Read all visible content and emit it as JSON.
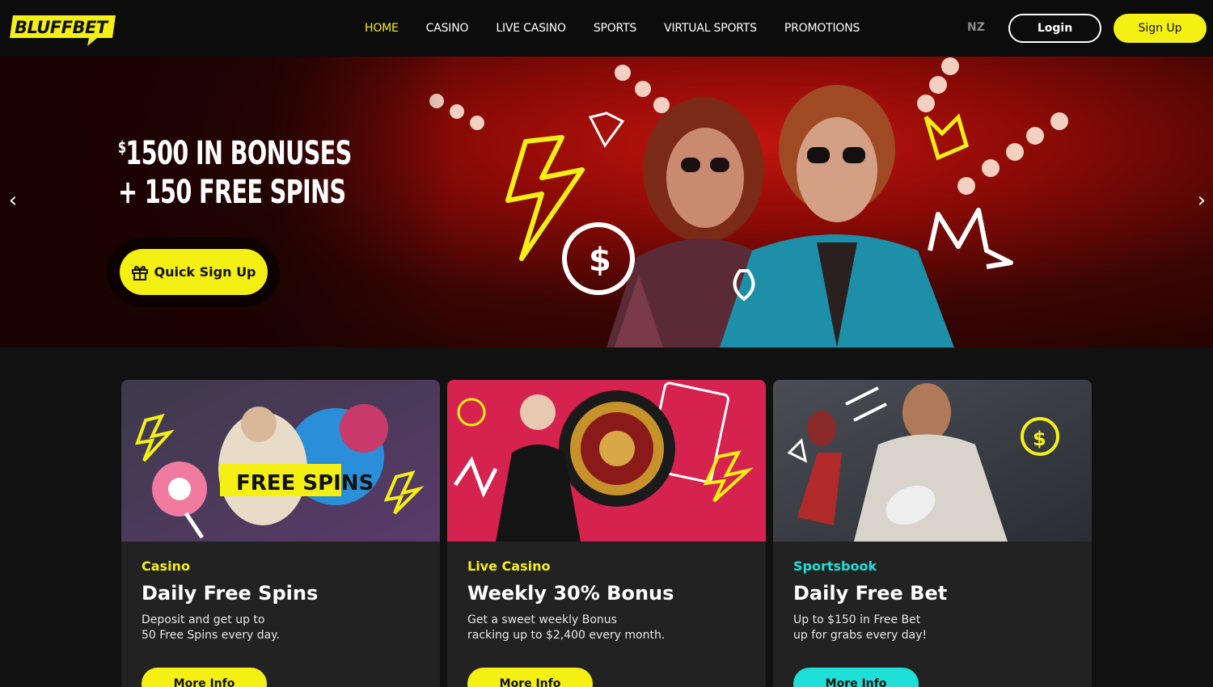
{
  "brand": {
    "name": "BLUFFBET",
    "accent": "#f5f014",
    "teal": "#1ee0d8"
  },
  "nav": {
    "items": [
      {
        "label": "HOME",
        "active": true
      },
      {
        "label": "CASINO",
        "active": false
      },
      {
        "label": "LIVE CASINO",
        "active": false
      },
      {
        "label": "SPORTS",
        "active": false
      },
      {
        "label": "VIRTUAL SPORTS",
        "active": false
      },
      {
        "label": "PROMOTIONS",
        "active": false
      }
    ],
    "region": "NZ",
    "login_label": "Login",
    "signup_label": "Sign Up"
  },
  "hero": {
    "currency": "$",
    "line1": "1500 IN BONUSES",
    "line2_prefix": "+",
    "line2": "150 FREE SPINS",
    "cta_label": "Quick Sign Up",
    "cta_icon": "gift-icon",
    "prev_icon": "chevron-left-icon",
    "next_icon": "chevron-right-icon"
  },
  "cards": [
    {
      "category": "Casino",
      "category_color": "#f5f014",
      "title": "Daily Free Spins",
      "desc_line1": "Deposit and get up to",
      "desc_line2": "50 Free Spins every day.",
      "image_label": "FREE SPINS",
      "button_label": "More Info",
      "button_color": "#f5f014"
    },
    {
      "category": "Live Casino",
      "category_color": "#f5f014",
      "title": "Weekly 30% Bonus",
      "desc_line1": "Get a sweet weekly Bonus",
      "desc_line2": "racking up to $2,400 every month.",
      "button_label": "More Info",
      "button_color": "#f5f014"
    },
    {
      "category": "Sportsbook",
      "category_color": "#1ee0d8",
      "title": "Daily Free Bet",
      "desc_line1": "Up to $150 in Free Bet",
      "desc_line2": "up for grabs every day!",
      "button_label": "More Info",
      "button_color": "#1ee0d8"
    }
  ]
}
